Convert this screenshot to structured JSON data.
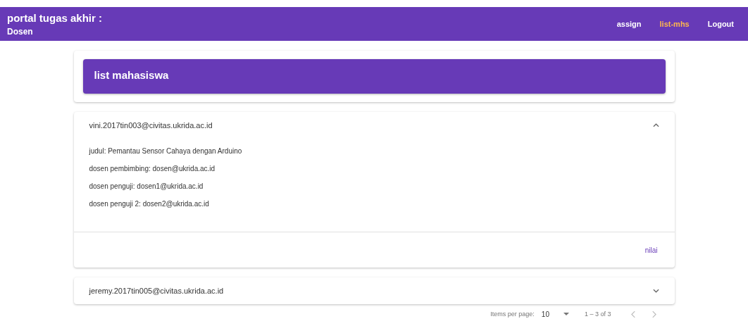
{
  "header": {
    "title": "portal tugas akhir :",
    "subtitle": "Dosen",
    "nav": [
      {
        "label": "assign",
        "selected": false
      },
      {
        "label": "list-mhs",
        "selected": true
      },
      {
        "label": "Logout",
        "selected": false
      }
    ]
  },
  "page_title": "list mahasiswa",
  "students": [
    {
      "email": "vini.2017tin003@civitas.ukrida.ac.id",
      "expanded": true,
      "details": [
        "judul: Pemantau Sensor Cahaya dengan Arduino",
        "dosen pembimbing: dosen@ukrida.ac.id",
        "dosen penguji: dosen1@ukrida.ac.id",
        "dosen penguji 2: dosen2@ukrida.ac.id"
      ],
      "action": "nilai"
    },
    {
      "email": "jeremy.2017tin005@civitas.ukrida.ac.id",
      "expanded": false
    }
  ],
  "paginator": {
    "label": "Items per page:",
    "page_size": "10",
    "range": "1 – 3 of 3"
  }
}
